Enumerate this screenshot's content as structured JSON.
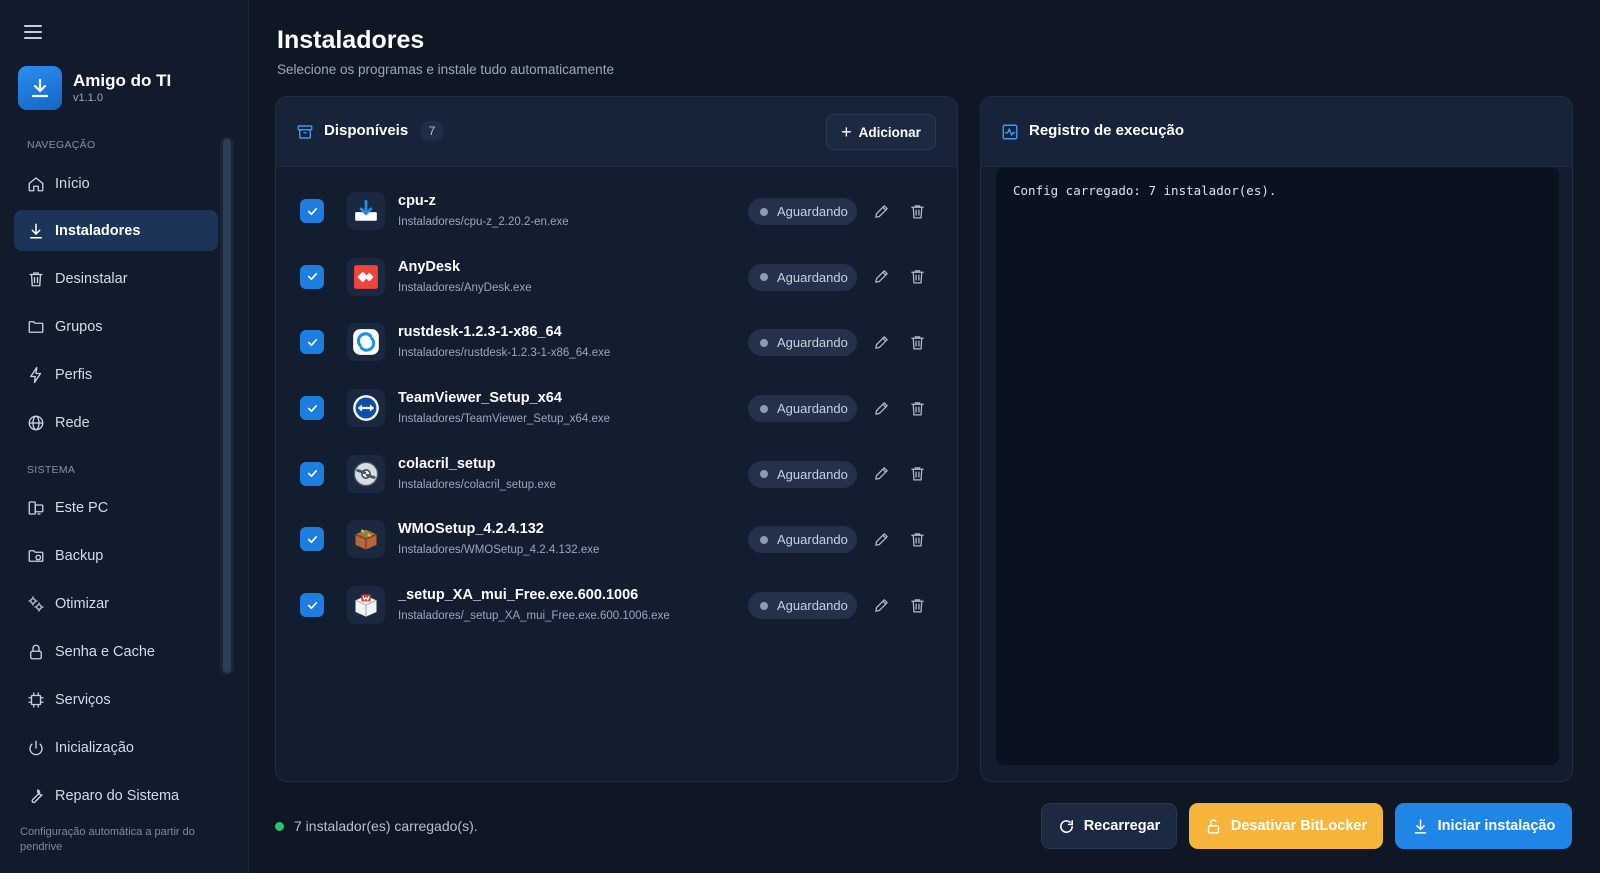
{
  "app": {
    "name": "Amigo do TI",
    "version": "v1.1.0",
    "logo_icon": "download-arrow-icon"
  },
  "sidebar": {
    "sections": [
      {
        "label": "NAVEGAÇÃO"
      },
      {
        "label": "SISTEMA"
      }
    ],
    "items": [
      {
        "label": "Início",
        "icon": "home-icon"
      },
      {
        "label": "Instaladores",
        "icon": "download-icon",
        "active": true
      },
      {
        "label": "Desinstalar",
        "icon": "trash-icon"
      },
      {
        "label": "Grupos",
        "icon": "folder-icon"
      },
      {
        "label": "Perfis",
        "icon": "bolt-icon"
      },
      {
        "label": "Rede",
        "icon": "globe-icon"
      },
      {
        "label": "Este PC",
        "icon": "computer-icon"
      },
      {
        "label": "Backup",
        "icon": "backup-folder-icon"
      },
      {
        "label": "Otimizar",
        "icon": "gears-icon"
      },
      {
        "label": "Senha e Cache",
        "icon": "lock-icon"
      },
      {
        "label": "Serviços",
        "icon": "chip-icon"
      },
      {
        "label": "Inicialização",
        "icon": "power-icon"
      },
      {
        "label": "Reparo do Sistema",
        "icon": "wrench-icon"
      }
    ],
    "footer": "Configuração automática a partir do pendrive"
  },
  "header": {
    "title": "Instaladores",
    "subtitle": "Selecione os programas e instale tudo automaticamente"
  },
  "installers_panel": {
    "title": "Disponíveis",
    "count": "7",
    "add_label": "Adicionar",
    "items": [
      {
        "name": "cpu-z",
        "path": "Instaladores/cpu-z_2.20.2-en.exe",
        "status": "Aguardando",
        "checked": true,
        "icon": "installer-icon"
      },
      {
        "name": "AnyDesk",
        "path": "Instaladores/AnyDesk.exe",
        "status": "Aguardando",
        "checked": true,
        "icon": "anydesk-icon"
      },
      {
        "name": "rustdesk-1.2.3-1-x86_64",
        "path": "Instaladores/rustdesk-1.2.3-1-x86_64.exe",
        "status": "Aguardando",
        "checked": true,
        "icon": "rustdesk-icon"
      },
      {
        "name": "TeamViewer_Setup_x64",
        "path": "Instaladores/TeamViewer_Setup_x64.exe",
        "status": "Aguardando",
        "checked": true,
        "icon": "teamviewer-icon"
      },
      {
        "name": "colacril_setup",
        "path": "Instaladores/colacril_setup.exe",
        "status": "Aguardando",
        "checked": true,
        "icon": "disc-icon"
      },
      {
        "name": "WMOSetup_4.2.4.132",
        "path": "Instaladores/WMOSetup_4.2.4.132.exe",
        "status": "Aguardando",
        "checked": true,
        "icon": "package-box-icon"
      },
      {
        "name": "_setup_XA_mui_Free.exe.600.1006",
        "path": "Instaladores/_setup_XA_mui_Free.exe.600.1006.exe",
        "status": "Aguardando",
        "checked": true,
        "icon": "setup-box-icon"
      }
    ]
  },
  "log_panel": {
    "title": "Registro de execução",
    "text": "Config carregado: 7 instalador(es)."
  },
  "footer": {
    "status": "7 instalador(es) carregado(s).",
    "reload_label": "Recarregar",
    "bitlocker_label": "Desativar BitLocker",
    "install_label": "Iniciar instalação"
  },
  "colors": {
    "accent": "#1f86e6",
    "warning": "#f4b53a",
    "success": "#27c46b",
    "background": "#0f1724"
  }
}
